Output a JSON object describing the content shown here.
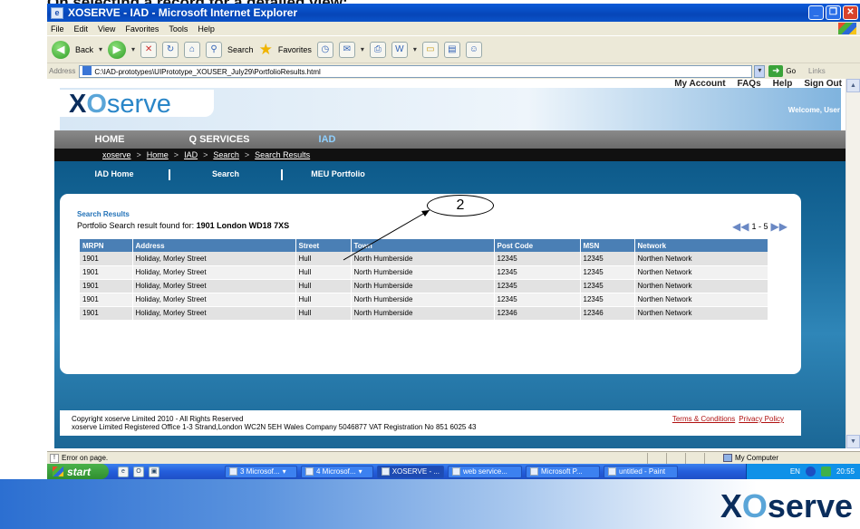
{
  "slide": {
    "caption": "On selecting a record for a detailed view:"
  },
  "browser": {
    "title": "XOSERVE - IAD - Microsoft Internet Explorer",
    "menu": [
      "File",
      "Edit",
      "View",
      "Favorites",
      "Tools",
      "Help"
    ],
    "toolbar": {
      "back": "Back",
      "search": "Search",
      "favorites": "Favorites"
    },
    "address_label": "Address",
    "address": "C:\\IAD-prototypes\\UIPrototype_XOUSER_July29\\PortfolioResults.html",
    "go": "Go",
    "links": "Links",
    "status": "Error on page.",
    "zone": "My Computer"
  },
  "site": {
    "top_links": [
      "My Account",
      "FAQs",
      "Help",
      "Sign Out"
    ],
    "welcome": "Welcome, User",
    "logo": {
      "a": "X",
      "b": "O",
      "c": "serve"
    },
    "nav": [
      "HOME",
      "Q SERVICES",
      "IAD"
    ],
    "breadcrumb": [
      "xoserve",
      "Home",
      "IAD",
      "Search",
      "Search Results"
    ],
    "breadcrumb_sep": ">",
    "subnav": [
      "IAD Home",
      "Search",
      "MEU Portfolio"
    ]
  },
  "results": {
    "title": "Search Results",
    "summary_prefix": "Portfolio Search result found for:",
    "summary_query": "1901 London WD18 7XS",
    "pager": "1 - 5",
    "columns": [
      "MRPN",
      "Address",
      "Street",
      "Town",
      "Post Code",
      "MSN",
      "Network"
    ],
    "rows": [
      [
        "1901",
        "Holiday, Morley Street",
        "Hull",
        "North Humberside",
        "12345",
        "12345",
        "Northen Network"
      ],
      [
        "1901",
        "Holiday, Morley Street",
        "Hull",
        "North Humberside",
        "12345",
        "12345",
        "Northen Network"
      ],
      [
        "1901",
        "Holiday, Morley Street",
        "Hull",
        "North Humberside",
        "12345",
        "12345",
        "Northen Network"
      ],
      [
        "1901",
        "Holiday, Morley Street",
        "Hull",
        "North Humberside",
        "12345",
        "12345",
        "Northen Network"
      ],
      [
        "1901",
        "Holiday, Morley Street",
        "Hull",
        "North Humberside",
        "12346",
        "12346",
        "Northen Network"
      ]
    ],
    "callout": "2"
  },
  "footer": {
    "copyright": "Copyright xoserve Limited 2010 - All Rights Reserved",
    "registered": "xoserve Limited Registered Office 1-3 Strand,London WC2N 5EH Wales Company 5046877 VAT Registration No 851 6025 43",
    "terms": "Terms & Conditions",
    "privacy": "Privacy Policy"
  },
  "taskbar": {
    "start": "start",
    "tasks": [
      "3 Microsof...",
      "4 Microsof...",
      "XOSERVE - ...",
      "web service...",
      "Microsoft P...",
      "untitled - Paint"
    ],
    "lang": "EN",
    "clock": "20:55"
  },
  "slide_logo": {
    "a": "X",
    "b": "O",
    "c": "serve"
  }
}
